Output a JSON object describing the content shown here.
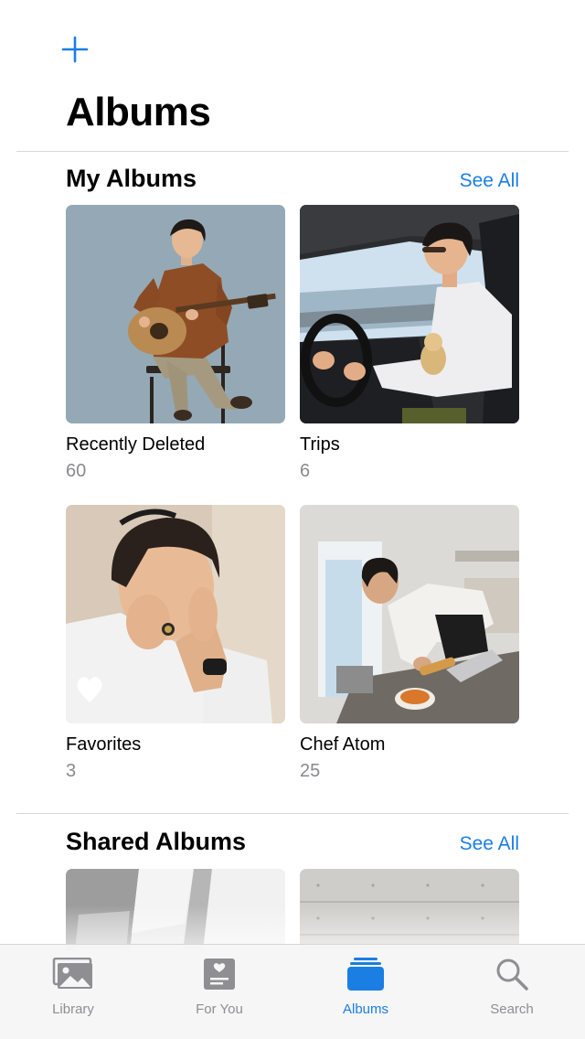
{
  "header": {
    "title": "Albums",
    "add_icon": "plus-icon"
  },
  "my_albums": {
    "title": "My Albums",
    "see_all": "See All",
    "items": [
      {
        "name": "Recently Deleted",
        "count": "60"
      },
      {
        "name": "Trips",
        "count": "6"
      },
      {
        "name": "Favorites",
        "count": "3"
      },
      {
        "name": "Chef Atom",
        "count": "25"
      }
    ]
  },
  "shared_albums": {
    "title": "Shared Albums",
    "see_all": "See All"
  },
  "tabbar": {
    "tabs": [
      {
        "label": "Library",
        "icon": "photo-library-icon",
        "active": false
      },
      {
        "label": "For You",
        "icon": "for-you-icon",
        "active": false
      },
      {
        "label": "Albums",
        "icon": "albums-icon",
        "active": true
      },
      {
        "label": "Search",
        "icon": "search-icon",
        "active": false
      }
    ]
  },
  "colors": {
    "accent": "#1a7ee3",
    "secondary_text": "#8a8a8e",
    "inactive_tab": "#8e8e93"
  }
}
